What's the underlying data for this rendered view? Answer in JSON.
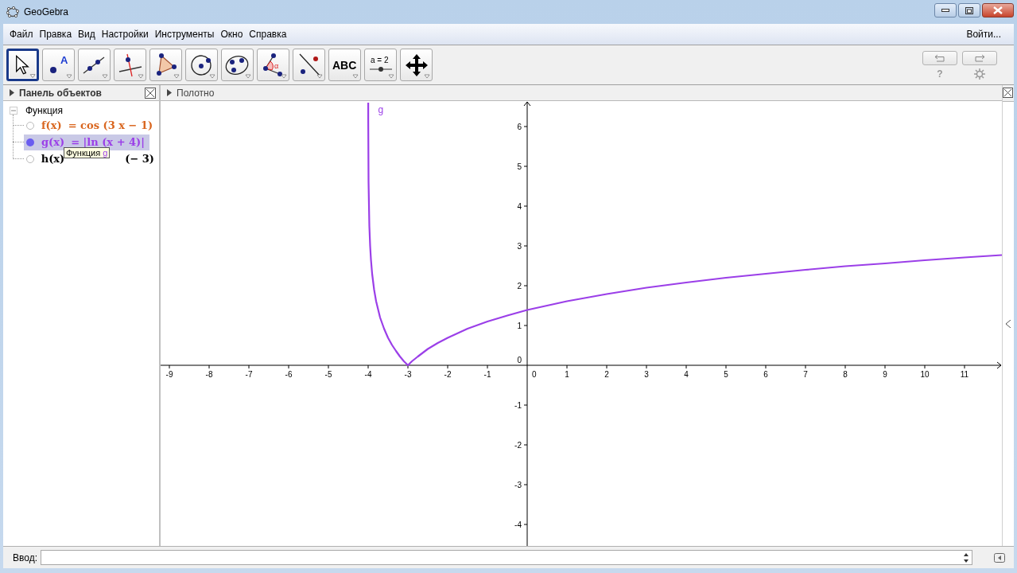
{
  "window": {
    "title": "GeoGebra"
  },
  "menu": {
    "items": [
      "Файл",
      "Правка",
      "Вид",
      "Настройки",
      "Инструменты",
      "Окно",
      "Справка"
    ],
    "login": "Войти..."
  },
  "toolbar": {
    "tools": [
      {
        "kind": "move",
        "selected": true
      },
      {
        "kind": "point",
        "label": "A",
        "selected": false
      },
      {
        "kind": "line",
        "selected": false
      },
      {
        "kind": "perpendicular",
        "selected": false
      },
      {
        "kind": "polygon",
        "selected": false
      },
      {
        "kind": "circle",
        "selected": false
      },
      {
        "kind": "conic",
        "selected": false
      },
      {
        "kind": "angle",
        "label": "α",
        "selected": false
      },
      {
        "kind": "reflect",
        "selected": false
      },
      {
        "kind": "text",
        "label": "ABC",
        "selected": false
      },
      {
        "kind": "slider",
        "label": "a = 2",
        "selected": false
      },
      {
        "kind": "pan",
        "selected": false
      }
    ],
    "help": "?"
  },
  "algebra_panel": {
    "title": "Панель объектов",
    "category": "Функция",
    "expanded": true,
    "items": [
      {
        "name": "f(x)",
        "formula": "= cos (3 x − 1)",
        "color": "#d9661f",
        "shown": false,
        "selected": false
      },
      {
        "name": "g(x)",
        "formula": "= |ln (x + 4)|",
        "color": "#9b3fe8",
        "shown": true,
        "selected": true
      },
      {
        "name": "h(x)",
        "formula": "(− 3)",
        "color": "#000000",
        "shown": false,
        "selected": false
      }
    ],
    "tooltip": {
      "text": "Функция",
      "object": "g"
    }
  },
  "graphics_panel": {
    "title": "Полотно",
    "origin_labels": [
      "0",
      "0"
    ],
    "chart_data": {
      "type": "line",
      "x": [
        -3.9987,
        -3.998,
        -3.99,
        -3.97,
        -3.95,
        -3.93,
        -3.9,
        -3.85,
        -3.8,
        -3.7,
        -3.6,
        -3.5,
        -3.4,
        -3.3,
        -3.2,
        -3.1,
        -3,
        -2.9,
        -2.75,
        -2.5,
        -2.25,
        -2,
        -1.5,
        -1,
        -0.5,
        0,
        1,
        2,
        3,
        4,
        5,
        6,
        7,
        8,
        9,
        10,
        11,
        11.94
      ],
      "series": [
        {
          "name": "g",
          "color": "#9b3fe8",
          "values": [
            6.6,
            6.2,
            4.6,
            3.5,
            3,
            2.66,
            2.3,
            1.9,
            1.61,
            1.2,
            0.92,
            0.69,
            0.51,
            0.36,
            0.22,
            0.1,
            0,
            0.1,
            0.22,
            0.41,
            0.56,
            0.69,
            0.92,
            1.1,
            1.25,
            1.39,
            1.61,
            1.79,
            1.95,
            2.08,
            2.2,
            2.3,
            2.4,
            2.49,
            2.56,
            2.64,
            2.71,
            2.77
          ]
        }
      ],
      "xlim": [
        -9.22,
        11.94
      ],
      "ylim": [
        -4.54,
        6.64
      ],
      "xticks": [
        -9,
        -8,
        -7,
        -6,
        -5,
        -4,
        -3,
        -2,
        -1,
        1,
        2,
        3,
        4,
        5,
        6,
        7,
        8,
        9,
        10,
        11
      ],
      "yticks": [
        -4,
        -3,
        -2,
        -1,
        1,
        2,
        3,
        4,
        5,
        6
      ]
    }
  },
  "input_bar": {
    "label": "Ввод:"
  }
}
